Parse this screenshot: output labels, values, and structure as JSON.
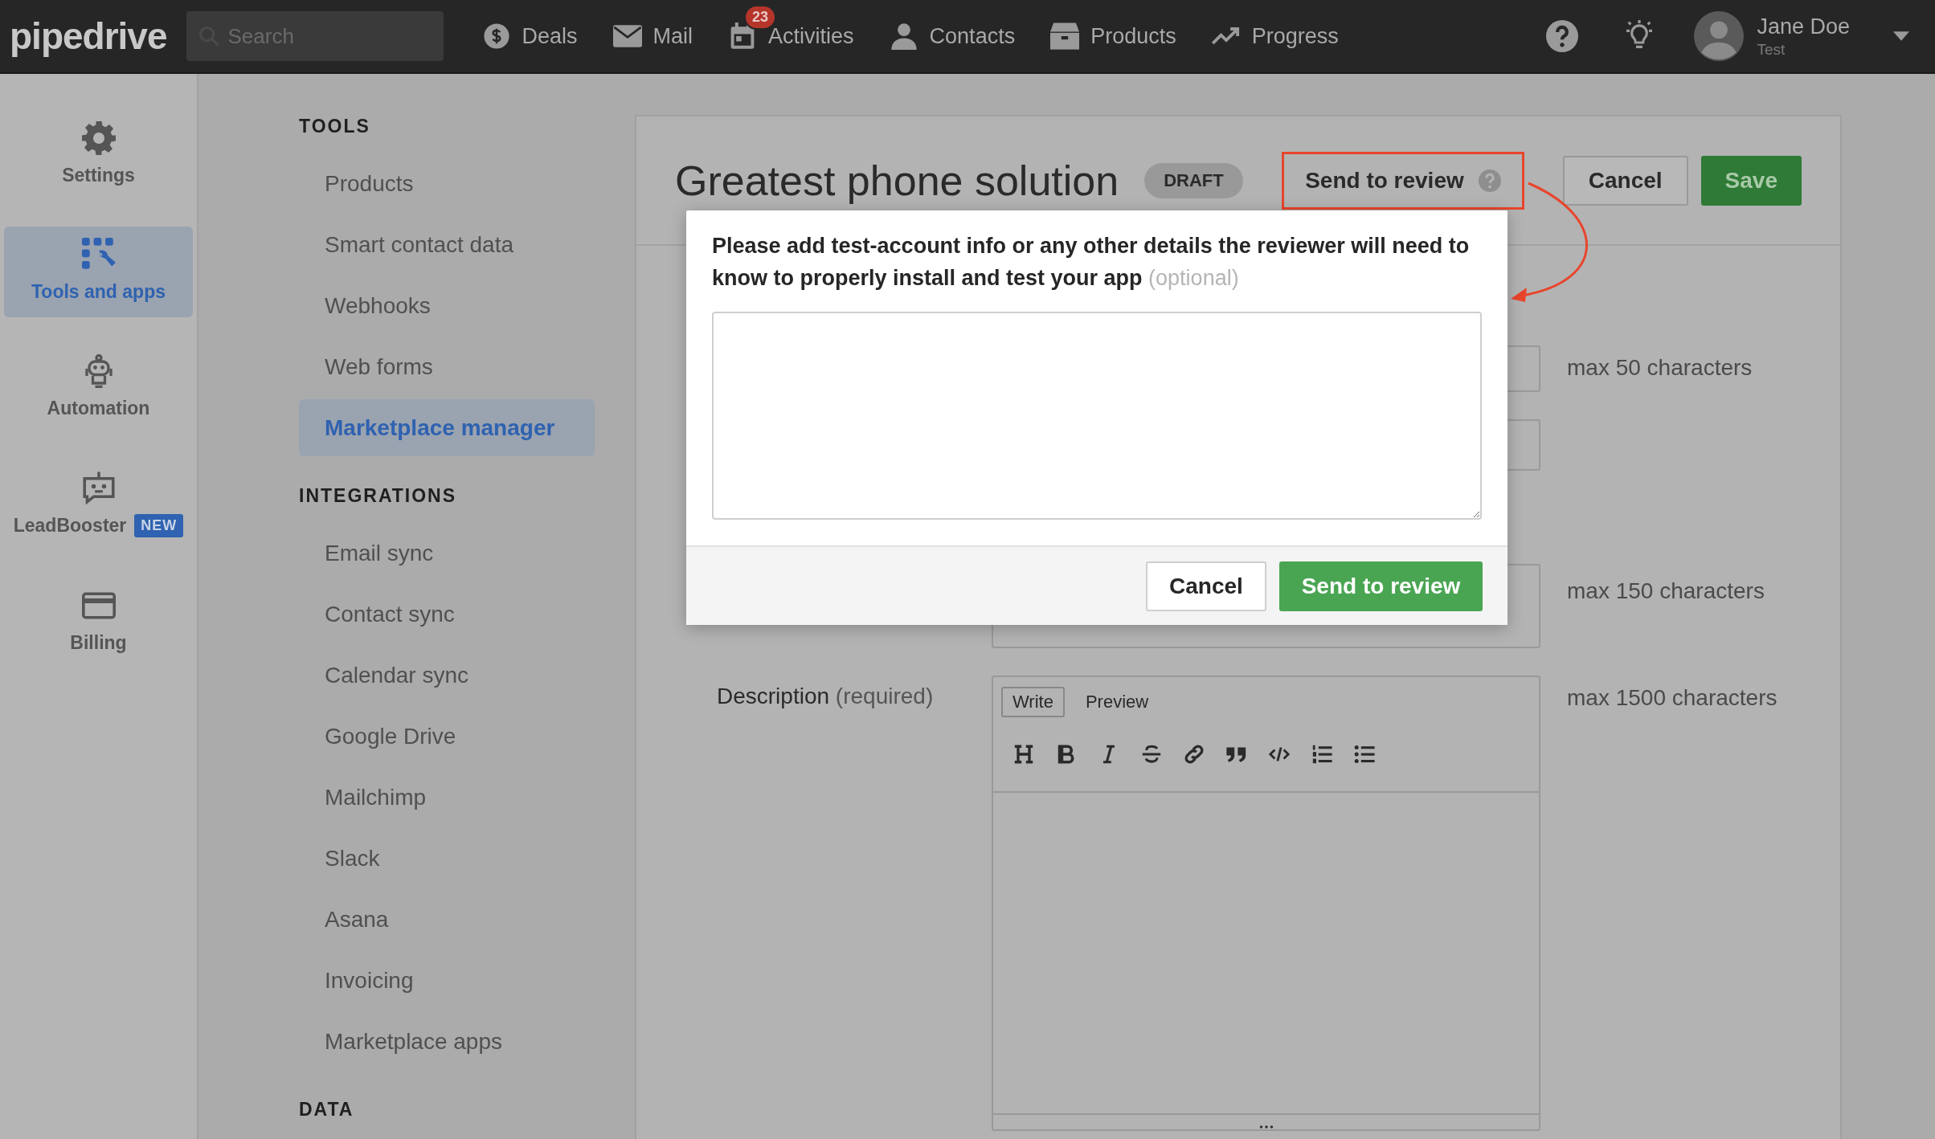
{
  "top_bar": {
    "logo": "pipedrive",
    "search": {
      "placeholder": "Search"
    },
    "nav": [
      {
        "label": "Deals"
      },
      {
        "label": "Mail"
      },
      {
        "label": "Activities",
        "badge": "23"
      },
      {
        "label": "Contacts"
      },
      {
        "label": "Products"
      },
      {
        "label": "Progress"
      }
    ],
    "user": {
      "name": "Jane Doe",
      "subtitle": "Test"
    }
  },
  "rail": [
    {
      "label": "Settings",
      "selected": false
    },
    {
      "label": "Tools and apps",
      "selected": true
    },
    {
      "label": "Automation",
      "selected": false
    },
    {
      "label": "LeadBooster",
      "badge": "NEW",
      "selected": false
    },
    {
      "label": "Billing",
      "selected": false
    }
  ],
  "menu": [
    {
      "heading": "TOOLS",
      "items": [
        {
          "label": "Products",
          "selected": false
        },
        {
          "label": "Smart contact data",
          "selected": false
        },
        {
          "label": "Webhooks",
          "selected": false
        },
        {
          "label": "Web forms",
          "selected": false
        },
        {
          "label": "Marketplace manager",
          "selected": true
        }
      ]
    },
    {
      "heading": "INTEGRATIONS",
      "items": [
        {
          "label": "Email sync",
          "selected": false
        },
        {
          "label": "Contact sync",
          "selected": false
        },
        {
          "label": "Calendar sync",
          "selected": false
        },
        {
          "label": "Google Drive",
          "selected": false
        },
        {
          "label": "Mailchimp",
          "selected": false
        },
        {
          "label": "Slack",
          "selected": false
        },
        {
          "label": "Asana",
          "selected": false
        },
        {
          "label": "Invoicing",
          "selected": false
        },
        {
          "label": "Marketplace apps",
          "selected": false
        }
      ]
    },
    {
      "heading": "DATA"
    }
  ],
  "editor": {
    "title": "Greatest phone solution",
    "status": "DRAFT",
    "actions": [
      {
        "label": "Send to review",
        "kind": "review",
        "highlighted": true
      },
      {
        "label": "Cancel",
        "kind": "secondary"
      },
      {
        "label": "Save",
        "kind": "primary"
      }
    ],
    "fields": [
      {
        "kind": "input",
        "hint": "max 50 characters"
      },
      {
        "kind": "input"
      },
      {
        "kind": "textarea",
        "hint": "max 150 characters"
      },
      {
        "kind": "markdown",
        "label": "Description",
        "note": "(required)",
        "hint": "max 1500 characters",
        "tabs": [
          {
            "label": "Write",
            "selected": true
          },
          {
            "label": "Preview",
            "selected": false
          }
        ],
        "toolbar": [
          {
            "kind": "heading"
          },
          {
            "kind": "bold"
          },
          {
            "kind": "italic"
          },
          {
            "kind": "strike"
          },
          {
            "kind": "link"
          },
          {
            "kind": "quote"
          },
          {
            "kind": "code"
          },
          {
            "kind": "ordered-list"
          },
          {
            "kind": "bullet-list"
          }
        ]
      }
    ]
  },
  "modal": {
    "message": "Please add test-account info or any other details the reviewer will need to know to properly install and test your app",
    "optional": "(optional)",
    "buttons": [
      {
        "label": "Cancel",
        "kind": "secondary"
      },
      {
        "label": "Send to review",
        "kind": "primary"
      }
    ]
  }
}
